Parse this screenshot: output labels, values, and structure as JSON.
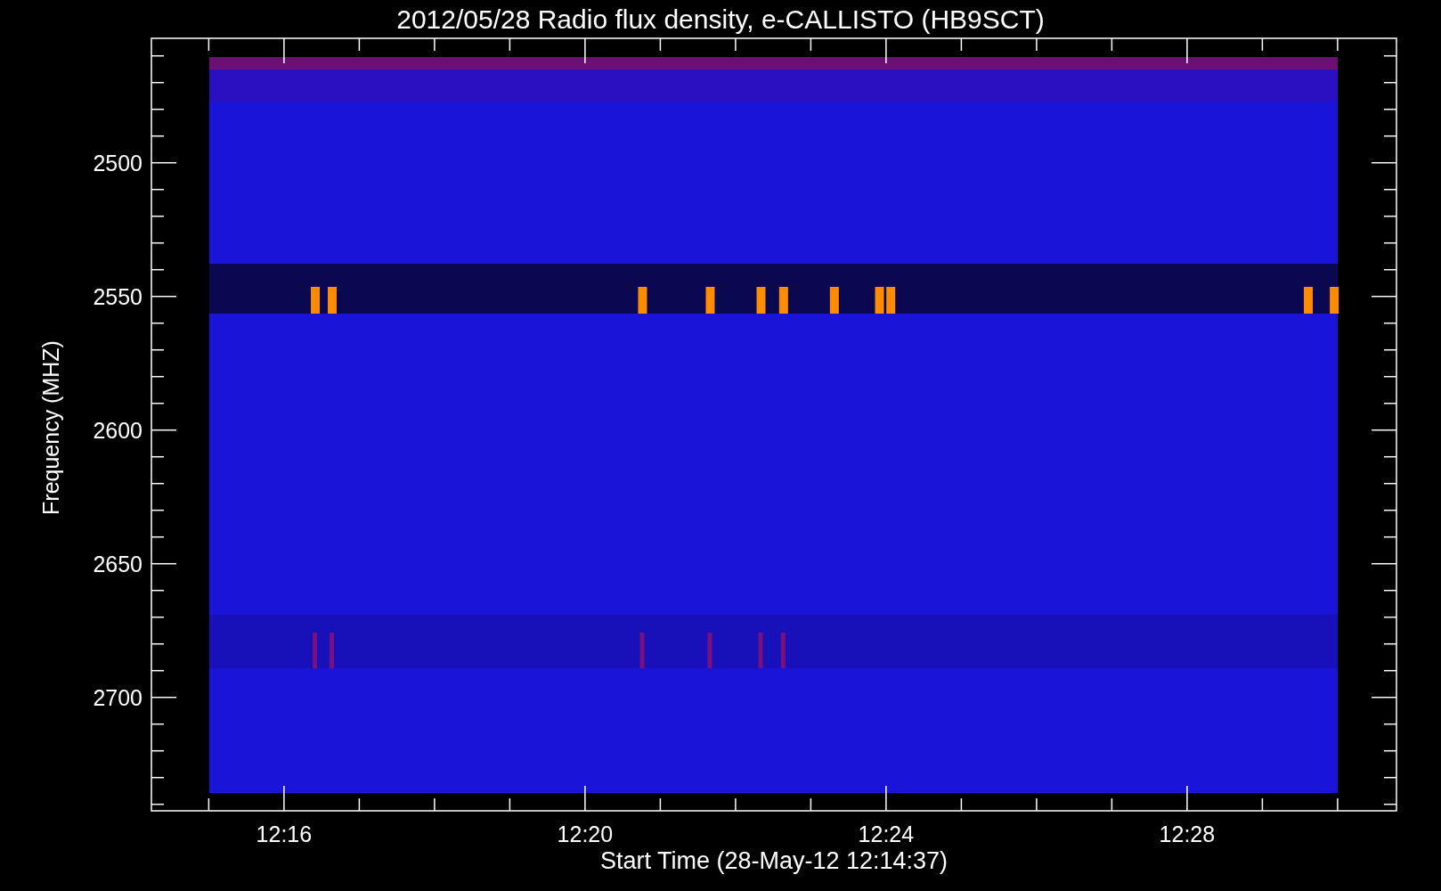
{
  "title": "2012/05/28  Radio flux density, e-CALLISTO (HB9SCT)",
  "y_axis": {
    "label": "Frequency (MHZ)",
    "ticks": [
      "2500",
      "2550",
      "2600",
      "2650",
      "2700"
    ]
  },
  "x_axis": {
    "label": "Start Time (28-May-12 12:14:37)",
    "ticks": [
      "12:16",
      "12:20",
      "12:24",
      "12:28"
    ]
  }
}
